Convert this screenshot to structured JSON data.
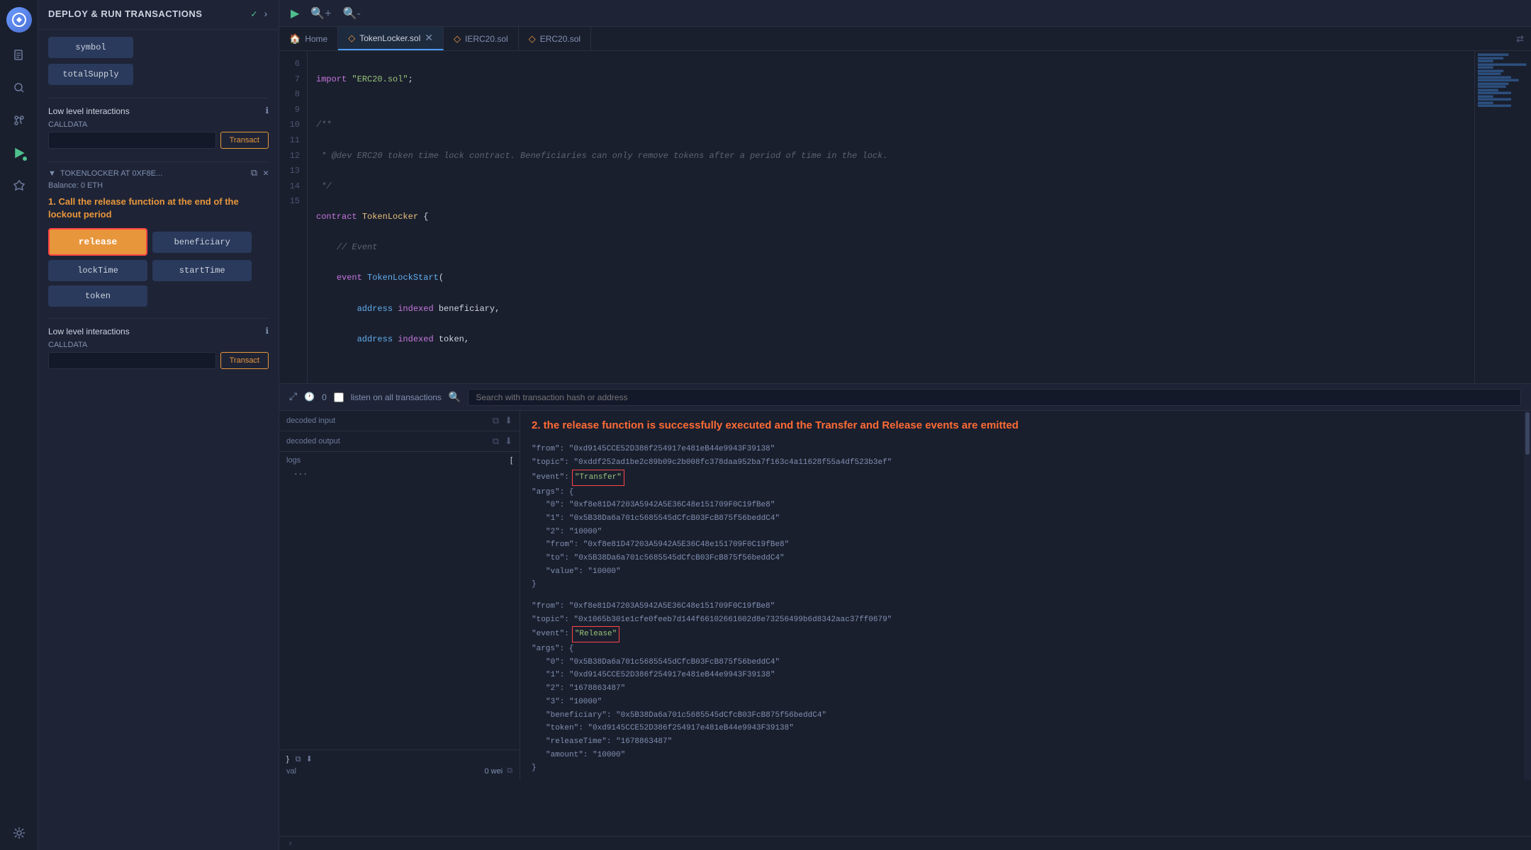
{
  "app": {
    "title": "DEPLOY & RUN TRANSACTIONS"
  },
  "sidebar": {
    "icons": [
      {
        "name": "file-icon",
        "symbol": "📄",
        "active": false
      },
      {
        "name": "search-icon",
        "symbol": "🔍",
        "active": false
      },
      {
        "name": "git-icon",
        "symbol": "⑂",
        "active": false
      },
      {
        "name": "deploy-icon",
        "symbol": "▶",
        "active": true
      },
      {
        "name": "plugin-icon",
        "symbol": "⊕",
        "active": false
      },
      {
        "name": "settings-icon",
        "symbol": "⚙",
        "active": false
      }
    ]
  },
  "deploy_panel": {
    "title": "DEPLOY & RUN\nTRANSACTIONS",
    "buttons": [
      {
        "label": "symbol",
        "name": "symbol-btn"
      },
      {
        "label": "totalSupply",
        "name": "total-supply-btn"
      }
    ],
    "low_level": {
      "title": "Low level interactions",
      "calldata_label": "CALLDATA",
      "transact_label": "Transact"
    },
    "deployed_contract": {
      "title": "TOKENLOCKER AT 0XF8E...",
      "balance": "Balance: 0 ETH",
      "instruction": "1. Call the release function at the end of the lockout period",
      "functions": [
        {
          "label": "release",
          "name": "release-btn",
          "highlighted": true
        },
        {
          "label": "beneficiary",
          "name": "beneficiary-btn"
        },
        {
          "label": "lockTime",
          "name": "lock-time-btn"
        },
        {
          "label": "startTime",
          "name": "start-time-btn"
        },
        {
          "label": "token",
          "name": "token-btn"
        }
      ],
      "low_level2": {
        "title": "Low level interactions",
        "calldata_label": "CALLDATA",
        "transact_label": "Transact"
      }
    }
  },
  "editor": {
    "tabs": [
      {
        "label": "Home",
        "icon": "🏠",
        "active": false,
        "closeable": false
      },
      {
        "label": "TokenLocker.sol",
        "icon": "◇",
        "active": true,
        "closeable": true
      },
      {
        "label": "IERC20.sol",
        "icon": "◇",
        "active": false,
        "closeable": false
      },
      {
        "label": "ERC20.sol",
        "icon": "◇",
        "active": false,
        "closeable": false
      }
    ],
    "code_lines": [
      {
        "num": "6",
        "code": "import \"ERC20.sol\";",
        "type": "import"
      },
      {
        "num": "7",
        "code": ""
      },
      {
        "num": "8",
        "code": "/**"
      },
      {
        "num": "9",
        "code": " * @dev ERC20 token time lock contract. Beneficiaries can only remove tokens after a period of time in the lock."
      },
      {
        "num": "10",
        "code": " */"
      },
      {
        "num": "11",
        "code": "contract TokenLocker {"
      },
      {
        "num": "12",
        "code": "    // Event"
      },
      {
        "num": "13",
        "code": "    event TokenLockStart("
      },
      {
        "num": "14",
        "code": "        address indexed beneficiary,"
      },
      {
        "num": "15",
        "code": "        address indexed token,"
      }
    ]
  },
  "transaction_panel": {
    "counter": "0",
    "listen_label": "listen on all transactions",
    "search_placeholder": "Search with transaction hash or address",
    "decoded_input_label": "decoded input",
    "decoded_output_label": "decoded output",
    "logs_label": "logs",
    "val_label": "val",
    "val_value": "0 wei",
    "result_instruction": "2. the release function is successfully executed and the\nTransfer and Release events are emitted",
    "log1": {
      "from": "\"from\": \"0xd9145CCE52D386f254917e481eB44e9943F39138\"",
      "topic": "\"topic\": \"0xddf252ad1be2c89b09c2b008fc378daa952ba7f163c4a11628f55a4df523b3ef\"",
      "event_key": "\"event\":",
      "event_val": "\"Transfer\"",
      "args": "\"args\": {",
      "arg0": "\"0\": \"0xf8e81D47203A5942A5E36C48e151709F0C19fBe8\"",
      "arg1": "\"1\": \"0x5B38Da6a701c5685545dCfcB03FcB875f56beddC4\"",
      "arg2": "\"2\": \"10000\"",
      "from2": "\"from\": \"0xf8e81D47203A5942A5E36C48e151709F0C19fBe8\"",
      "to": "\"to\": \"0x5B38Da6a701c5685545dCfcB03FcB875f56beddC4\"",
      "value": "\"value\": \"10000\""
    },
    "log2": {
      "from": "\"from\": \"0xf8e81D47203A5942A5E36C48e151709F0C19fBe8\"",
      "topic": "\"topic\": \"0x1065b301e1cfe0feeb7d144f66102661602d8e73256499b6d8342aac37ff0679\"",
      "event_key": "\"event\":",
      "event_val": "\"Release\"",
      "args": "\"args\": {",
      "arg0": "\"0\": \"0x5B38Da6a701c5685545dCfcB03FcB875f56beddC4\"",
      "arg1": "\"1\": \"0xd9145CCE52D386f254917e481eB44e9943F39138\"",
      "arg2": "\"2\": \"1678863487\"",
      "arg3": "\"3\": \"10000\"",
      "beneficiary": "\"beneficiary\": \"0x5B38Da6a701c5685545dCfcB03FcB875f56beddC4\"",
      "token": "\"token\": \"0xd9145CCE52D386f254917e481eB44e9943F39138\"",
      "releaseTime": "\"releaseTime\": \"1678863487\"",
      "amount": "\"amount\": \"10000\""
    }
  },
  "colors": {
    "accent_orange": "#e8963c",
    "accent_green": "#4fc08d",
    "accent_blue": "#4a9eff",
    "highlight_red": "#ff4444",
    "text_primary": "#cdd3de",
    "text_secondary": "#8090b0",
    "bg_dark": "#1a1f2e",
    "bg_medium": "#1e2436",
    "bg_panel": "#2a3040"
  }
}
